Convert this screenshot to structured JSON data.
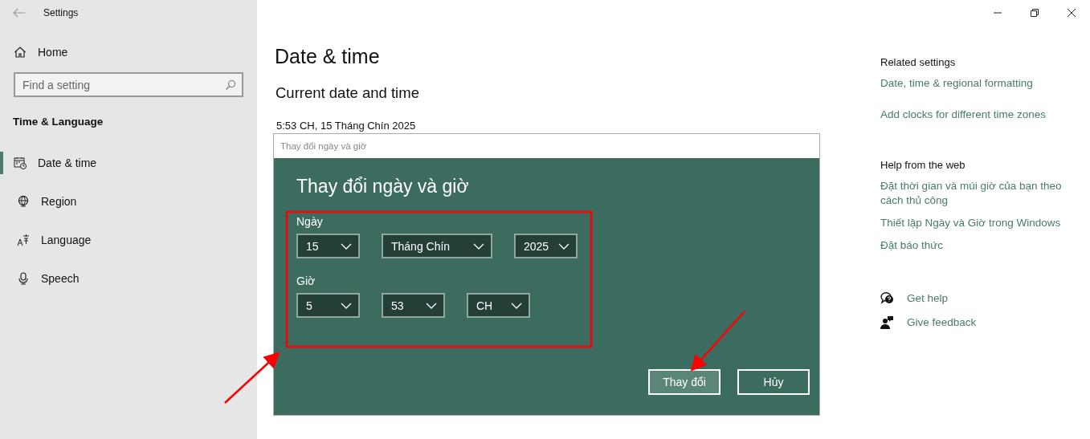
{
  "window": {
    "title": "Settings"
  },
  "sidebar": {
    "home": "Home",
    "search": {
      "placeholder": "Find a setting"
    },
    "section": "Time & Language",
    "items": [
      {
        "label": "Date & time",
        "selected": true
      },
      {
        "label": "Region",
        "selected": false
      },
      {
        "label": "Language",
        "selected": false
      },
      {
        "label": "Speech",
        "selected": false
      }
    ]
  },
  "page": {
    "title": "Date & time",
    "subtitle": "Current date and time",
    "current": "5:53 CH, 15 Tháng Chín 2025"
  },
  "dialog": {
    "window_title": "Thay đổi ngày và giờ",
    "heading": "Thay đổi ngày và giờ",
    "groups": [
      {
        "label": "Ngày",
        "fields": [
          {
            "value": "15",
            "kind": "short"
          },
          {
            "value": "Tháng Chín",
            "kind": "wide"
          },
          {
            "value": "2025",
            "kind": "short"
          }
        ]
      },
      {
        "label": "Giờ",
        "fields": [
          {
            "value": "5",
            "kind": "short"
          },
          {
            "value": "53",
            "kind": "short"
          },
          {
            "value": "CH",
            "kind": "short"
          }
        ]
      }
    ],
    "buttons": [
      {
        "label": "Thay đổi",
        "kind": "accent"
      },
      {
        "label": "Hủy",
        "kind": "plain"
      }
    ]
  },
  "related": {
    "title": "Related settings",
    "links": [
      "Date, time & regional formatting",
      "Add clocks for different time zones"
    ]
  },
  "help": {
    "title": "Help from the web",
    "links": [
      "Đặt thời gian và múi giờ của bạn theo cách thủ công",
      "Thiết lập Ngày và Giờ trong Windows",
      "Đặt báo thức"
    ]
  },
  "support": [
    {
      "label": "Get help"
    },
    {
      "label": "Give feedback"
    }
  ]
}
